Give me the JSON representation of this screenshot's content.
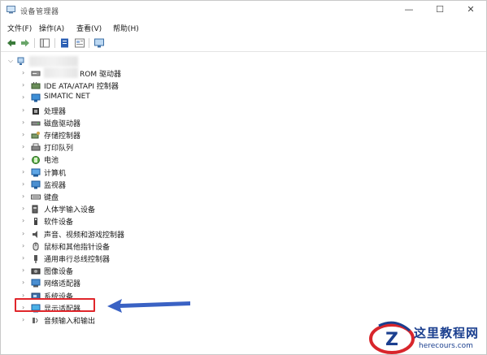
{
  "window": {
    "title": "设备管理器",
    "controls": [
      "—",
      "☐",
      "✕"
    ]
  },
  "menu": [
    {
      "label": "文件(F)"
    },
    {
      "label": "操作(A)"
    },
    {
      "label": "查看(V)"
    },
    {
      "label": "帮助(H)"
    }
  ],
  "tree": {
    "items": [
      {
        "label": "ROM 驱动器",
        "icon": "dvd-drive-icon"
      },
      {
        "label": "IDE ATA/ATAPI 控制器",
        "icon": "ide-controller-icon"
      },
      {
        "label": "SIMATIC NET",
        "icon": "network-monitor-icon"
      },
      {
        "label": "处理器",
        "icon": "processor-icon"
      },
      {
        "label": "磁盘驱动器",
        "icon": "disk-drive-icon"
      },
      {
        "label": "存储控制器",
        "icon": "storage-controller-icon"
      },
      {
        "label": "打印队列",
        "icon": "printer-icon"
      },
      {
        "label": "电池",
        "icon": "battery-icon"
      },
      {
        "label": "计算机",
        "icon": "computer-icon"
      },
      {
        "label": "监视器",
        "icon": "monitor-icon"
      },
      {
        "label": "键盘",
        "icon": "keyboard-icon"
      },
      {
        "label": "人体学输入设备",
        "icon": "hid-icon"
      },
      {
        "label": "软件设备",
        "icon": "software-device-icon"
      },
      {
        "label": "声音、视频和游戏控制器",
        "icon": "sound-icon"
      },
      {
        "label": "鼠标和其他指针设备",
        "icon": "mouse-icon"
      },
      {
        "label": "通用串行总线控制器",
        "icon": "usb-icon"
      },
      {
        "label": "图像设备",
        "icon": "camera-icon"
      },
      {
        "label": "网络适配器",
        "icon": "network-adapter-icon"
      },
      {
        "label": "系统设备",
        "icon": "system-device-icon"
      },
      {
        "label": "显示适配器",
        "icon": "display-adapter-icon"
      },
      {
        "label": "音频输入和输出",
        "icon": "audio-io-icon"
      }
    ]
  },
  "watermark": {
    "title": "这里教程网",
    "url": "herecours.com",
    "accent": "#1b3f8f",
    "logo_color": "#d8262c"
  },
  "colors": {
    "highlight_box": "#e0262b",
    "arrow": "#3a62c4"
  }
}
